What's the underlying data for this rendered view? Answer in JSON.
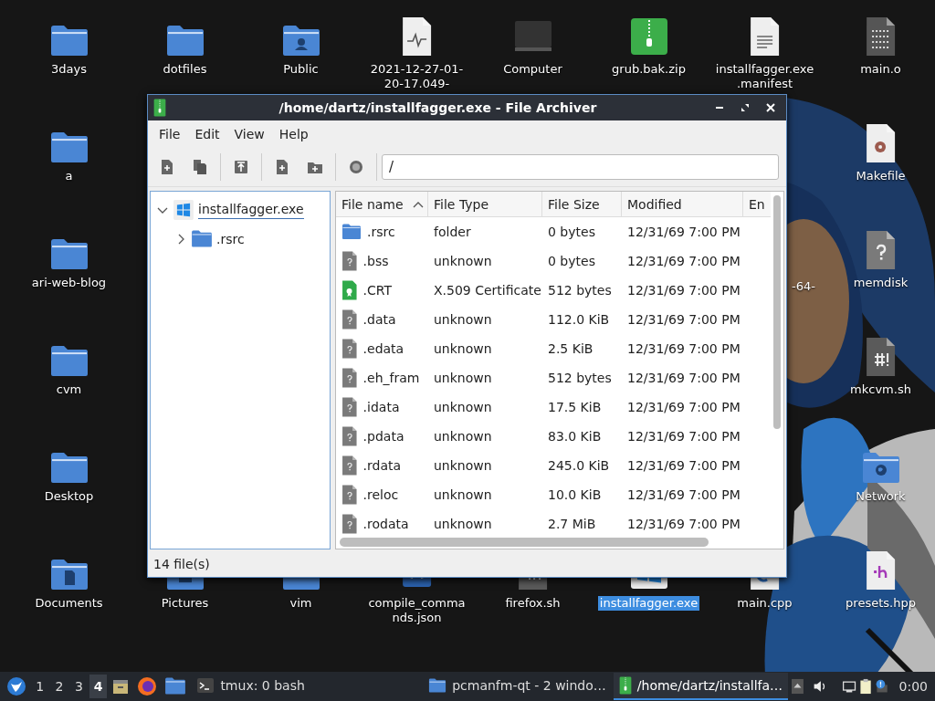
{
  "desktop_icons": [
    {
      "label": "3days",
      "kind": "folder",
      "selected": false
    },
    {
      "label": "dotfiles",
      "kind": "folder",
      "selected": false
    },
    {
      "label": "Public",
      "kind": "folder-user",
      "selected": false
    },
    {
      "label": "2021-12-27-01-20-17.049-",
      "kind": "log",
      "selected": false
    },
    {
      "label": "Computer",
      "kind": "computer",
      "selected": false
    },
    {
      "label": "grub.bak.zip",
      "kind": "zip",
      "selected": false
    },
    {
      "label": "installfagger.exe .manifest",
      "kind": "text",
      "selected": false
    },
    {
      "label": "main.o",
      "kind": "binary",
      "selected": false
    },
    {
      "label": "a",
      "kind": "folder",
      "selected": false
    },
    {
      "label": "Makefile",
      "kind": "makefile",
      "selected": false
    },
    {
      "label": "ari-web-blog",
      "kind": "folder",
      "selected": false
    },
    {
      "label": "-64-",
      "kind": "covered",
      "selected": false
    },
    {
      "label": "memdisk",
      "kind": "unknown",
      "selected": false
    },
    {
      "label": "cvm",
      "kind": "folder",
      "selected": false
    },
    {
      "label": "mkcvm.sh",
      "kind": "script",
      "selected": false
    },
    {
      "label": "Desktop",
      "kind": "folder",
      "selected": false
    },
    {
      "label": "Network",
      "kind": "folder-network",
      "selected": false
    },
    {
      "label": "Documents",
      "kind": "folder-docs",
      "selected": false
    },
    {
      "label": "Pictures",
      "kind": "folder-pictures",
      "selected": false
    },
    {
      "label": "vim",
      "kind": "folder",
      "selected": false
    },
    {
      "label": "compile_commands.json",
      "kind": "json",
      "selected": false
    },
    {
      "label": "firefox.sh",
      "kind": "script",
      "selected": false
    },
    {
      "label": "installfagger.exe",
      "kind": "exe",
      "selected": true
    },
    {
      "label": "main.cpp",
      "kind": "cpp",
      "selected": false
    },
    {
      "label": "presets.hpp",
      "kind": "hpp",
      "selected": false
    }
  ],
  "window": {
    "title": "/home/dartz/installfagger.exe - File Archiver",
    "menu": [
      "File",
      "Edit",
      "View",
      "Help"
    ],
    "path": "/",
    "tree": [
      {
        "label": "installfagger.exe",
        "kind": "exe",
        "expanded": true,
        "children": [
          {
            "label": ".rsrc",
            "kind": "folder",
            "expanded": false
          }
        ]
      }
    ],
    "table": {
      "columns": [
        {
          "label": "File name",
          "sorted": true
        },
        {
          "label": "File Type",
          "sorted": false
        },
        {
          "label": "File Size",
          "sorted": false
        },
        {
          "label": "Modified",
          "sorted": false
        },
        {
          "label": "En",
          "sorted": false
        }
      ],
      "rows": [
        {
          "name": ".rsrc",
          "kind": "folder",
          "type": "folder",
          "size": "0 bytes",
          "modified": "12/31/69 7:00 PM"
        },
        {
          "name": ".bss",
          "kind": "unknown",
          "type": "unknown",
          "size": "0 bytes",
          "modified": "12/31/69 7:00 PM"
        },
        {
          "name": ".CRT",
          "kind": "certificate",
          "type": "X.509 Certificate",
          "size": "512 bytes",
          "modified": "12/31/69 7:00 PM"
        },
        {
          "name": ".data",
          "kind": "unknown",
          "type": "unknown",
          "size": "112.0 KiB",
          "modified": "12/31/69 7:00 PM"
        },
        {
          "name": ".edata",
          "kind": "unknown",
          "type": "unknown",
          "size": "2.5 KiB",
          "modified": "12/31/69 7:00 PM"
        },
        {
          "name": ".eh_fram",
          "kind": "unknown",
          "type": "unknown",
          "size": "512 bytes",
          "modified": "12/31/69 7:00 PM"
        },
        {
          "name": ".idata",
          "kind": "unknown",
          "type": "unknown",
          "size": "17.5 KiB",
          "modified": "12/31/69 7:00 PM"
        },
        {
          "name": ".pdata",
          "kind": "unknown",
          "type": "unknown",
          "size": "83.0 KiB",
          "modified": "12/31/69 7:00 PM"
        },
        {
          "name": ".rdata",
          "kind": "unknown",
          "type": "unknown",
          "size": "245.0 KiB",
          "modified": "12/31/69 7:00 PM"
        },
        {
          "name": ".reloc",
          "kind": "unknown",
          "type": "unknown",
          "size": "10.0 KiB",
          "modified": "12/31/69 7:00 PM"
        },
        {
          "name": ".rodata",
          "kind": "unknown",
          "type": "unknown",
          "size": "2.7 MiB",
          "modified": "12/31/69 7:00 PM"
        }
      ]
    },
    "status": "14 file(s)"
  },
  "taskbar": {
    "workspaces": [
      {
        "label": "1",
        "selected": false
      },
      {
        "label": "2",
        "selected": false
      },
      {
        "label": "3",
        "selected": false
      },
      {
        "label": "4",
        "selected": true
      }
    ],
    "tasks": [
      {
        "label": "tmux: 0 bash",
        "kind": "terminal",
        "selected": false
      },
      {
        "label": "pcmanfm-qt - 2 windo…",
        "kind": "folder",
        "selected": false
      },
      {
        "label": "/home/dartz/installfa…",
        "kind": "archive",
        "selected": true
      }
    ],
    "clock": "0:00"
  }
}
